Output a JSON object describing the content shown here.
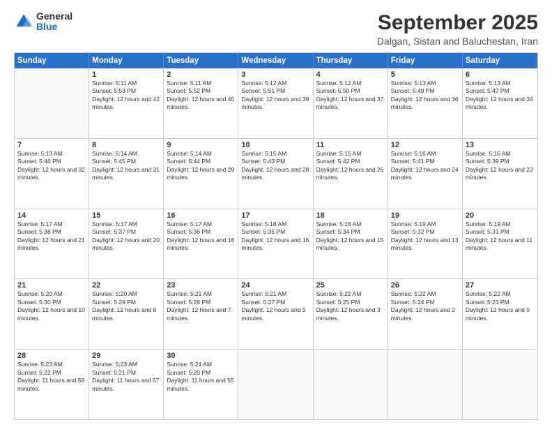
{
  "logo": {
    "general": "General",
    "blue": "Blue"
  },
  "title": "September 2025",
  "subtitle": "Dalgan, Sistan and Baluchestan, Iran",
  "header": {
    "days": [
      "Sunday",
      "Monday",
      "Tuesday",
      "Wednesday",
      "Thursday",
      "Friday",
      "Saturday"
    ]
  },
  "weeks": [
    [
      {
        "day": "",
        "sunrise": "",
        "sunset": "",
        "daylight": "",
        "empty": true
      },
      {
        "day": "1",
        "sunrise": "Sunrise: 5:11 AM",
        "sunset": "Sunset: 5:53 PM",
        "daylight": "Daylight: 12 hours and 42 minutes."
      },
      {
        "day": "2",
        "sunrise": "Sunrise: 5:11 AM",
        "sunset": "Sunset: 5:52 PM",
        "daylight": "Daylight: 12 hours and 40 minutes."
      },
      {
        "day": "3",
        "sunrise": "Sunrise: 5:12 AM",
        "sunset": "Sunset: 5:51 PM",
        "daylight": "Daylight: 12 hours and 39 minutes."
      },
      {
        "day": "4",
        "sunrise": "Sunrise: 5:12 AM",
        "sunset": "Sunset: 5:50 PM",
        "daylight": "Daylight: 12 hours and 37 minutes."
      },
      {
        "day": "5",
        "sunrise": "Sunrise: 5:13 AM",
        "sunset": "Sunset: 5:49 PM",
        "daylight": "Daylight: 12 hours and 36 minutes."
      },
      {
        "day": "6",
        "sunrise": "Sunrise: 5:13 AM",
        "sunset": "Sunset: 5:47 PM",
        "daylight": "Daylight: 12 hours and 34 minutes."
      }
    ],
    [
      {
        "day": "7",
        "sunrise": "Sunrise: 5:13 AM",
        "sunset": "Sunset: 5:46 PM",
        "daylight": "Daylight: 12 hours and 32 minutes."
      },
      {
        "day": "8",
        "sunrise": "Sunrise: 5:14 AM",
        "sunset": "Sunset: 5:45 PM",
        "daylight": "Daylight: 12 hours and 31 minutes."
      },
      {
        "day": "9",
        "sunrise": "Sunrise: 5:14 AM",
        "sunset": "Sunset: 5:44 PM",
        "daylight": "Daylight: 12 hours and 29 minutes."
      },
      {
        "day": "10",
        "sunrise": "Sunrise: 5:15 AM",
        "sunset": "Sunset: 5:43 PM",
        "daylight": "Daylight: 12 hours and 28 minutes."
      },
      {
        "day": "11",
        "sunrise": "Sunrise: 5:15 AM",
        "sunset": "Sunset: 5:42 PM",
        "daylight": "Daylight: 12 hours and 26 minutes."
      },
      {
        "day": "12",
        "sunrise": "Sunrise: 5:16 AM",
        "sunset": "Sunset: 5:41 PM",
        "daylight": "Daylight: 12 hours and 24 minutes."
      },
      {
        "day": "13",
        "sunrise": "Sunrise: 5:16 AM",
        "sunset": "Sunset: 5:39 PM",
        "daylight": "Daylight: 12 hours and 23 minutes."
      }
    ],
    [
      {
        "day": "14",
        "sunrise": "Sunrise: 5:17 AM",
        "sunset": "Sunset: 5:38 PM",
        "daylight": "Daylight: 12 hours and 21 minutes."
      },
      {
        "day": "15",
        "sunrise": "Sunrise: 5:17 AM",
        "sunset": "Sunset: 5:37 PM",
        "daylight": "Daylight: 12 hours and 20 minutes."
      },
      {
        "day": "16",
        "sunrise": "Sunrise: 5:17 AM",
        "sunset": "Sunset: 5:36 PM",
        "daylight": "Daylight: 12 hours and 18 minutes."
      },
      {
        "day": "17",
        "sunrise": "Sunrise: 5:18 AM",
        "sunset": "Sunset: 5:35 PM",
        "daylight": "Daylight: 12 hours and 16 minutes."
      },
      {
        "day": "18",
        "sunrise": "Sunrise: 5:18 AM",
        "sunset": "Sunset: 5:34 PM",
        "daylight": "Daylight: 12 hours and 15 minutes."
      },
      {
        "day": "19",
        "sunrise": "Sunrise: 5:19 AM",
        "sunset": "Sunset: 5:32 PM",
        "daylight": "Daylight: 12 hours and 13 minutes."
      },
      {
        "day": "20",
        "sunrise": "Sunrise: 5:19 AM",
        "sunset": "Sunset: 5:31 PM",
        "daylight": "Daylight: 12 hours and 11 minutes."
      }
    ],
    [
      {
        "day": "21",
        "sunrise": "Sunrise: 5:20 AM",
        "sunset": "Sunset: 5:30 PM",
        "daylight": "Daylight: 12 hours and 10 minutes."
      },
      {
        "day": "22",
        "sunrise": "Sunrise: 5:20 AM",
        "sunset": "Sunset: 5:29 PM",
        "daylight": "Daylight: 12 hours and 8 minutes."
      },
      {
        "day": "23",
        "sunrise": "Sunrise: 5:21 AM",
        "sunset": "Sunset: 5:28 PM",
        "daylight": "Daylight: 12 hours and 7 minutes."
      },
      {
        "day": "24",
        "sunrise": "Sunrise: 5:21 AM",
        "sunset": "Sunset: 5:27 PM",
        "daylight": "Daylight: 12 hours and 5 minutes."
      },
      {
        "day": "25",
        "sunrise": "Sunrise: 5:22 AM",
        "sunset": "Sunset: 5:25 PM",
        "daylight": "Daylight: 12 hours and 3 minutes."
      },
      {
        "day": "26",
        "sunrise": "Sunrise: 5:22 AM",
        "sunset": "Sunset: 5:24 PM",
        "daylight": "Daylight: 12 hours and 2 minutes."
      },
      {
        "day": "27",
        "sunrise": "Sunrise: 5:22 AM",
        "sunset": "Sunset: 5:23 PM",
        "daylight": "Daylight: 12 hours and 0 minutes."
      }
    ],
    [
      {
        "day": "28",
        "sunrise": "Sunrise: 5:23 AM",
        "sunset": "Sunset: 5:22 PM",
        "daylight": "Daylight: 11 hours and 59 minutes."
      },
      {
        "day": "29",
        "sunrise": "Sunrise: 5:23 AM",
        "sunset": "Sunset: 5:21 PM",
        "daylight": "Daylight: 11 hours and 57 minutes."
      },
      {
        "day": "30",
        "sunrise": "Sunrise: 5:24 AM",
        "sunset": "Sunset: 5:20 PM",
        "daylight": "Daylight: 11 hours and 55 minutes."
      },
      {
        "day": "",
        "sunrise": "",
        "sunset": "",
        "daylight": "",
        "empty": true
      },
      {
        "day": "",
        "sunrise": "",
        "sunset": "",
        "daylight": "",
        "empty": true
      },
      {
        "day": "",
        "sunrise": "",
        "sunset": "",
        "daylight": "",
        "empty": true
      },
      {
        "day": "",
        "sunrise": "",
        "sunset": "",
        "daylight": "",
        "empty": true
      }
    ]
  ]
}
